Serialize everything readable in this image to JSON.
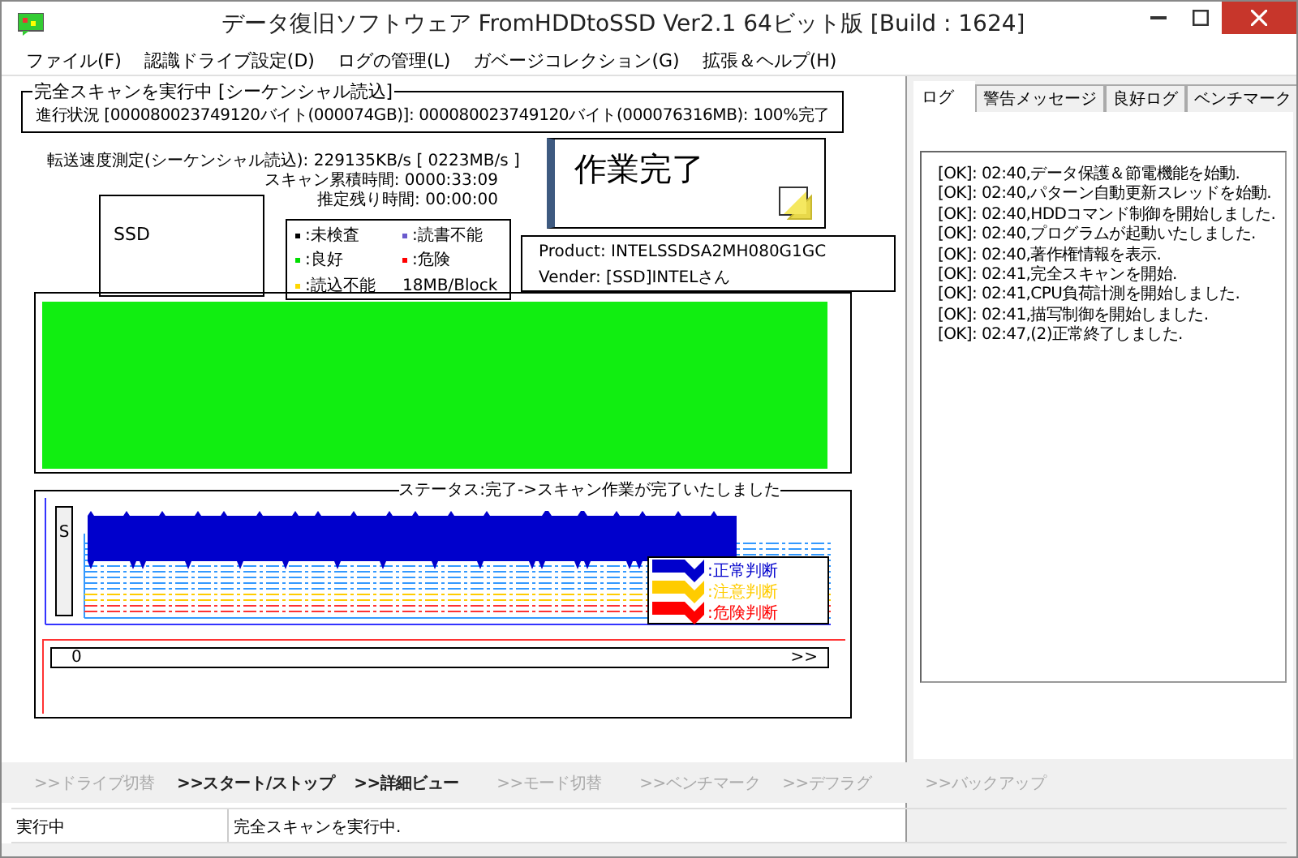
{
  "window": {
    "title": "データ復旧ソフトウェア FromHDDtoSSD Ver2.1 64ビット版 [Build : 1624]"
  },
  "menu": [
    "ファイル(F)",
    "認識ドライブ設定(D)",
    "ログの管理(L)",
    "ガベージコレクション(G)",
    "拡張＆ヘルプ(H)"
  ],
  "scan": {
    "title": "完全スキャンを実行中 [シーケンシャル読込]",
    "progress": "進行状況 [000080023749120バイト(000074GB)]: 000080023749120バイト(000076316MB): 100%完了"
  },
  "speed": "転送速度測定(シーケンシャル読込): 229135KB/s [ 0223MB/s ]",
  "elapsed": "スキャン累積時間: 0000:33:09",
  "remaining": "推定残り時間: 00:00:00",
  "drive_type": "SSD",
  "legend": [
    {
      "label": ":未検査",
      "color": "#000000"
    },
    {
      "label": ":読書不能",
      "color": "#6a5acd"
    },
    {
      "label": ":良好",
      "color": "#00dd00"
    },
    {
      "label": ":危険",
      "color": "#ff0000"
    },
    {
      "label": ":読込不能",
      "color": "#ffd700"
    }
  ],
  "block_size": "18MB/Block",
  "state_panel": {
    "title": "作業完了"
  },
  "device": {
    "product": "Product: INTELSSDSA2MH080G1GC",
    "vendor": "Vender: [SSD]INTELさん"
  },
  "block_map": {
    "level": 1
  },
  "status": {
    "title": "ステータス:完了->スキャン作業が完了いたしました",
    "axis_label": "S",
    "scroll_start": "0",
    "scroll_more": ">>",
    "judgements": [
      {
        "label": ":正常判断",
        "color": "#0000cc"
      },
      {
        "label": ":注意判断",
        "color": "#ffcc00"
      },
      {
        "label": ":危険判断",
        "color": "#ff0000"
      }
    ]
  },
  "log_tabs": [
    {
      "label": "ログ",
      "selected": true
    },
    {
      "label": "警告メッセージ",
      "selected": false
    },
    {
      "label": "良好ログ",
      "selected": false
    },
    {
      "label": "ベンチマーク",
      "selected": false
    }
  ],
  "log": [
    "[OK]: 02:40,データ保護＆節電機能を始動.",
    "[OK]: 02:40,パターン自動更新スレッドを始動.",
    "[OK]: 02:40,HDDコマンド制御を開始しました.",
    "[OK]: 02:40,プログラムが起動いたしました.",
    "[OK]: 02:40,著作権情報を表示.",
    "[OK]: 02:41,完全スキャンを開始.",
    "[OK]: 02:41,CPU負荷計測を開始しました.",
    "[OK]: 02:41,描写制御を開始しました.",
    "[OK]: 02:47,(2)正常終了しました."
  ],
  "toolbar": [
    {
      "label": ">>ドライブ切替",
      "disabled": true
    },
    {
      "label": ">>スタート/ストップ",
      "disabled": false
    },
    {
      "label": ">>詳細ビュー",
      "disabled": false
    },
    {
      "label": ">>モード切替",
      "disabled": true
    },
    {
      "label": ">>ベンチマーク",
      "disabled": true
    },
    {
      "label": ">>デフラグ",
      "disabled": true
    },
    {
      "label": ">>バックアップ",
      "disabled": true
    }
  ],
  "status_bar": [
    "実行中",
    "完全スキャンを実行中."
  ]
}
